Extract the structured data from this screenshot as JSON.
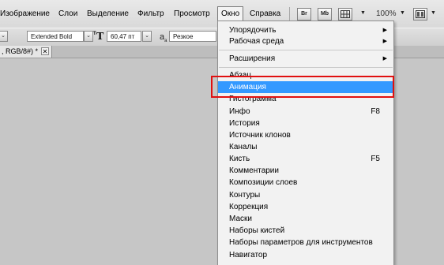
{
  "menubar": {
    "items": [
      "Изображение",
      "Слои",
      "Выделение",
      "Фильтр",
      "Просмотр",
      "Окно",
      "Справка"
    ],
    "br_label": "Br",
    "mb_label": "Mb",
    "zoom": "100%"
  },
  "options": {
    "font_style": "Extended Bold",
    "font_size": "60,47 пт",
    "antialias": "Резкое"
  },
  "document_tab": {
    "title": ", RGB/8#) *",
    "close": "✕"
  },
  "window_menu": {
    "items": [
      {
        "label": "Упорядочить",
        "submenu": true
      },
      {
        "label": "Рабочая среда",
        "submenu": true
      },
      {
        "label": "Расширения",
        "submenu": true
      },
      {
        "label": "Абзац"
      },
      {
        "label": "Анимация",
        "highlighted": true
      },
      {
        "label": "Гистограмма"
      },
      {
        "label": "Инфо",
        "shortcut": "F8"
      },
      {
        "label": "История"
      },
      {
        "label": "Источник клонов"
      },
      {
        "label": "Каналы"
      },
      {
        "label": "Кисть",
        "shortcut": "F5"
      },
      {
        "label": "Комментарии"
      },
      {
        "label": "Композиции слоев"
      },
      {
        "label": "Контуры"
      },
      {
        "label": "Коррекция"
      },
      {
        "label": "Маски"
      },
      {
        "label": "Наборы кистей"
      },
      {
        "label": "Наборы параметров для инструментов"
      },
      {
        "label": "Навигатор"
      }
    ]
  },
  "colors": {
    "highlight": "#3399ff",
    "annotation_box": "#e01010"
  }
}
